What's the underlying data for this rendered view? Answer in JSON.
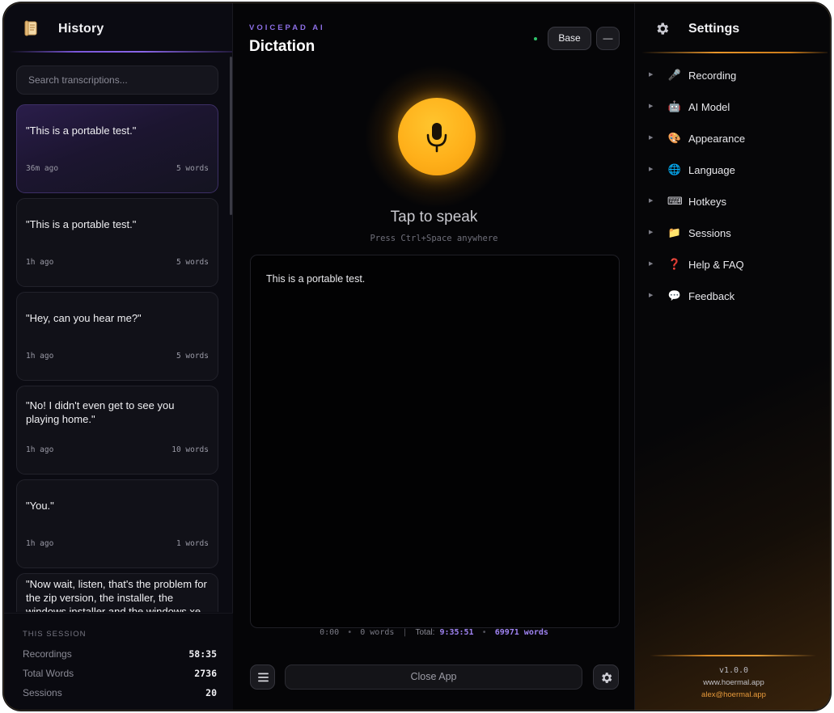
{
  "history": {
    "title": "History",
    "search_placeholder": "Search transcriptions...",
    "items": [
      {
        "text": "\"This is a portable test.\"",
        "time": "36m ago",
        "words": "5 words",
        "active": true
      },
      {
        "text": "\"This is a portable test.\"",
        "time": "1h ago",
        "words": "5 words"
      },
      {
        "text": "\"Hey, can you hear me?\"",
        "time": "1h ago",
        "words": "5 words"
      },
      {
        "text": "\"No! I didn't even get to see you playing home.\"",
        "time": "1h ago",
        "words": "10 words"
      },
      {
        "text": "\"You.\"",
        "time": "1h ago",
        "words": "1 words"
      },
      {
        "text": "\"Now wait, listen, that's the problem for the zip version, the installer, the windows installer and the windows xe"
      }
    ]
  },
  "session": {
    "heading": "THIS SESSION",
    "recordings_label": "Recordings",
    "recordings_value": "58:35",
    "total_words_label": "Total Words",
    "total_words_value": "2736",
    "sessions_label": "Sessions",
    "sessions_value": "20"
  },
  "main": {
    "brand": "VOICEPAD AI",
    "title": "Dictation",
    "model_button": "Base",
    "minimize_button": "—",
    "tap_text": "Tap to speak",
    "hotkey_hint": "Press Ctrl+Space anywhere",
    "transcript": "This is a portable test.",
    "stats": {
      "duration": "0:00",
      "words": "0 words",
      "total_label": "Total:",
      "total_time": "9:35:51",
      "total_words": "69971 words"
    },
    "close_button": "Close App"
  },
  "settings": {
    "title": "Settings",
    "items": [
      {
        "label": "Recording",
        "icon": "microphone-icon",
        "glyph": "🎤"
      },
      {
        "label": "AI Model",
        "icon": "robot-icon",
        "glyph": "🤖"
      },
      {
        "label": "Appearance",
        "icon": "palette-icon",
        "glyph": "🎨"
      },
      {
        "label": "Language",
        "icon": "globe-icon",
        "glyph": "🌐"
      },
      {
        "label": "Hotkeys",
        "icon": "keyboard-icon",
        "glyph": "⌨"
      },
      {
        "label": "Sessions",
        "icon": "folder-icon",
        "glyph": "📁"
      },
      {
        "label": "Help & FAQ",
        "icon": "question-icon",
        "glyph": "❓"
      },
      {
        "label": "Feedback",
        "icon": "speech-bubble-icon",
        "glyph": "💬"
      }
    ],
    "version": "v1.0.0",
    "website": "www.hoermal.app",
    "email": "alex@hoermal.app"
  },
  "colors": {
    "accent_purple": "#8d6fe6",
    "accent_orange": "#e8952a",
    "mic_yellow": "#ffb01a",
    "status_green": "#2fc46b"
  }
}
